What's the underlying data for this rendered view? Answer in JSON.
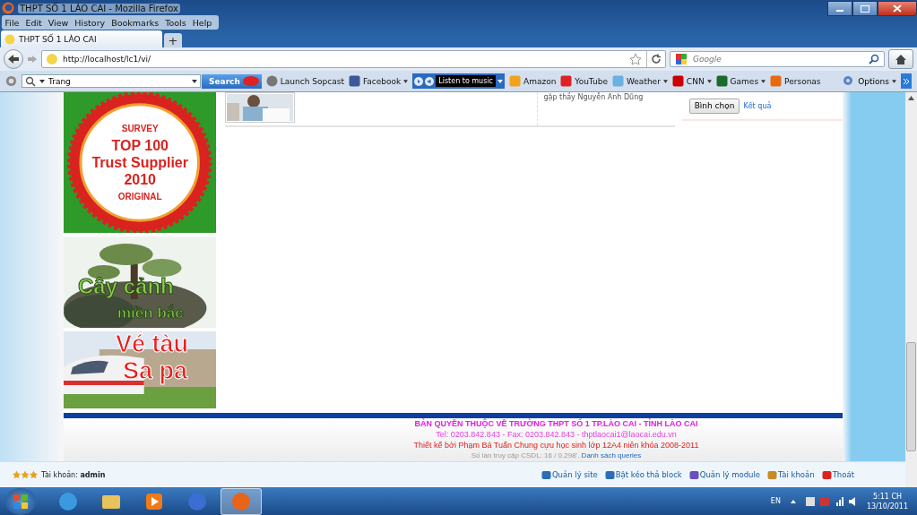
{
  "window": {
    "title": "THPT SỐ 1 LÀO CAI - Mozilla Firefox"
  },
  "menu": [
    "File",
    "Edit",
    "View",
    "History",
    "Bookmarks",
    "Tools",
    "Help"
  ],
  "tabs": [
    {
      "label": "THPT SỐ 1 LÀO CAI",
      "selected": true
    }
  ],
  "new_tab": "+",
  "address": {
    "value": "http://localhost/lc1/vi/"
  },
  "web_search": {
    "placeholder": "Google"
  },
  "toolbar": {
    "search_value": "Trang",
    "search_button": "Search",
    "player_label": "Listen to music",
    "items": [
      {
        "kind": "globe",
        "label": "Launch Sopcast",
        "dropdown": false
      },
      {
        "kind": "facebook",
        "label": "Facebook",
        "dropdown": true
      },
      {
        "kind": "player"
      },
      {
        "kind": "amazon",
        "label": "Amazon",
        "dropdown": false
      },
      {
        "kind": "youtube",
        "label": "YouTube",
        "dropdown": false
      },
      {
        "kind": "weather",
        "label": "Weather",
        "dropdown": true
      },
      {
        "kind": "cnn",
        "label": "CNN",
        "dropdown": true
      },
      {
        "kind": "games",
        "label": "Games",
        "dropdown": true
      },
      {
        "kind": "personas",
        "label": "Personas",
        "dropdown": false
      }
    ],
    "options": "Options"
  },
  "page": {
    "article_snippet": "gặp thầy Nguyễn Anh Dũng",
    "vote_button": "Bình chọn",
    "results_link": "Kết quả",
    "banners": [
      {
        "kind": "badge",
        "lines": [
          "SURVEY",
          "TOP 100",
          "Trust Supplier",
          "2010",
          "ORIGINAL"
        ]
      },
      {
        "kind": "bonsai",
        "lines": [
          "Cây cảnh",
          "miền bắc"
        ]
      },
      {
        "kind": "train",
        "lines": [
          "Vé tàu",
          "Sa pa"
        ]
      }
    ]
  },
  "footer": {
    "copyright": "BẢN QUYỀN THUỘC VỀ TRƯỜNG THPT SỐ 1 TP.LÀO CAI - TỈNH LÀO CAI",
    "contact": "Tel: 0203.842.843 - Fax: 0203.842.843 - thptlaocai1@laocai.edu.vn",
    "designer": "Thiết kế bởi Phạm Bá Tuấn Chung cựu học sinh lớp 12A4 niên khóa 2008-2011",
    "stats": "Số lần truy cập CSDL: 16 / 0.298'.",
    "stats_link": "Danh sách queries"
  },
  "admin_bar": {
    "account_label": "Tài khoản:",
    "account_name": "admin",
    "links": [
      "Quản lý site",
      "Bật kéo thả block",
      "Quản lý module",
      "Tài khoản",
      "Thoát"
    ]
  },
  "taskbar": {
    "apps": [
      {
        "kind": "ie",
        "selected": false
      },
      {
        "kind": "folder",
        "selected": false
      },
      {
        "kind": "media",
        "selected": false
      },
      {
        "kind": "itunes",
        "selected": false
      },
      {
        "kind": "firefox",
        "selected": true
      }
    ],
    "language": "EN",
    "time": "5:11 CH",
    "date": "13/10/2011"
  }
}
